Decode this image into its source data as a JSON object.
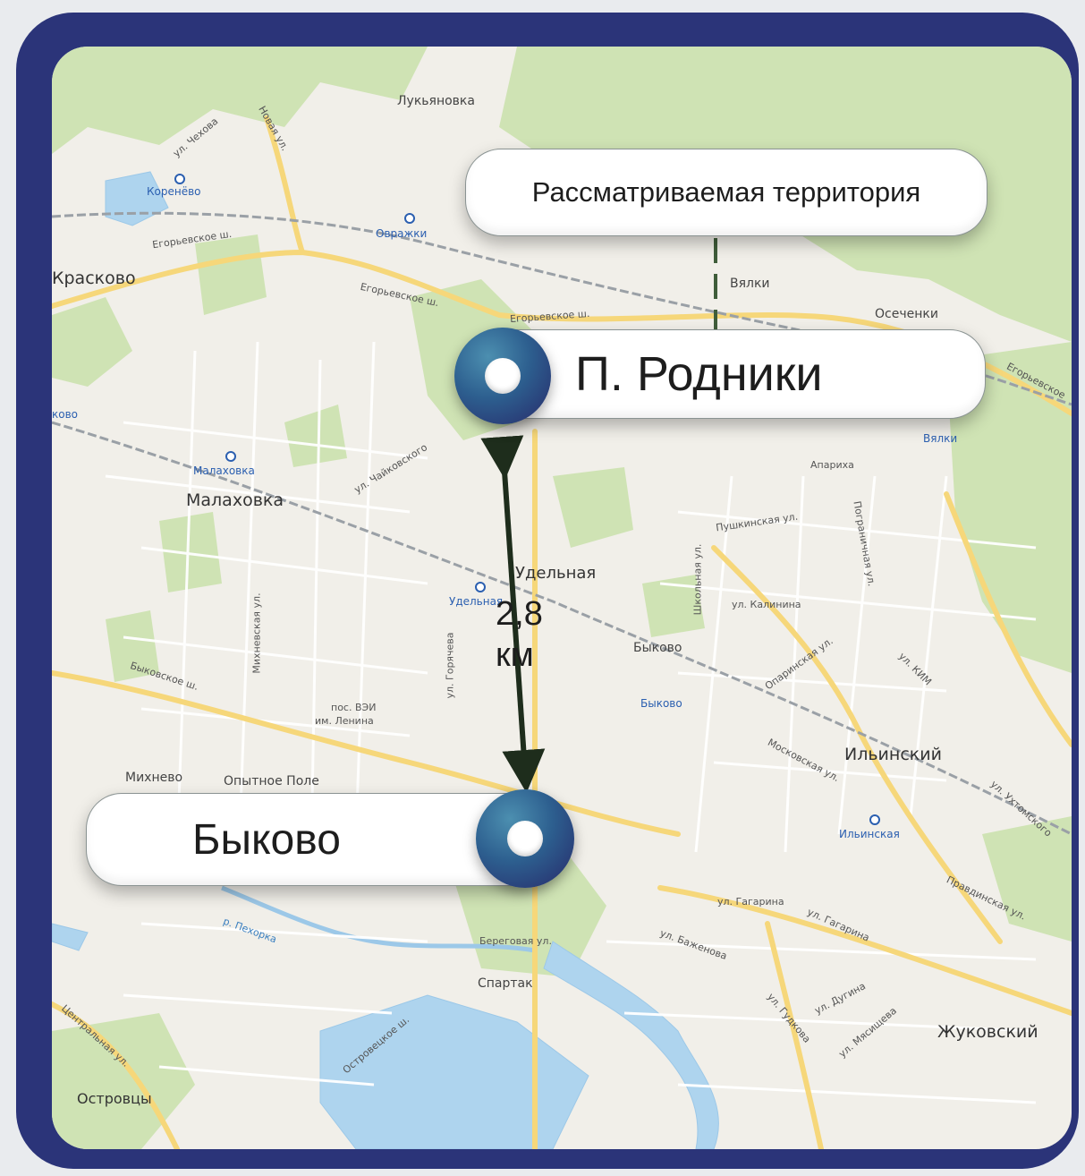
{
  "map": {
    "callouts": {
      "territory": "Рассматриваемая территория",
      "rodniki": "П. Родники",
      "bykovo": "Быково"
    },
    "distance": {
      "value": "2,8",
      "unit": "км"
    },
    "places": {
      "lukyanovka": "Лукьяновка",
      "korenevo": "Коренёво",
      "ovrazhki": "Овражки",
      "kraskovo": "Красково",
      "vyalki": "Вялки",
      "osechenki": "Осеченки",
      "vyalki_st": "Вялки",
      "apariha": "Апариха",
      "malakhovka_st": "Малаховка",
      "malakhovka": "Малаховка",
      "udelnaya": "Удельная",
      "udelnaya_st": "Удельная",
      "bykovo_town": "Быково",
      "bykovo_st": "Быково",
      "ilyinsky": "Ильинский",
      "ilyinskaya_st": "Ильинская",
      "pos_vei": "пос. ВЭИ",
      "im_lenina": "им. Ленина",
      "mikhnevo": "Михнево",
      "opytnoe_pole": "Опытное Поле",
      "spartak": "Спартак",
      "zhukovsky": "Жуковский",
      "ostrovtsy": "Островцы",
      "kosino_edge": "ково"
    },
    "roads": {
      "egor1": "Егорьевское ш.",
      "egor2": "Егорьевское ш.",
      "egor3": "Егорьевское ш.",
      "egor4": "Егорьевское",
      "chekhova": "ул. Чехова",
      "novaya": "Новая ул.",
      "chaikovskogo": "ул. Чайковского",
      "pushkinskaya": "Пушкинская ул.",
      "kalinina": "ул. Калинина",
      "shkolnaya": "Школьная ул.",
      "bykovskoe": "Быковское ш.",
      "mikhnevskaya": "Михневская ул.",
      "goryacheva": "ул. Горячева",
      "moskovskaya": "Московская ул.",
      "oparinskaya": "Опаринская ул.",
      "kim": "ул. КИМ",
      "gagarina1": "ул. Гагарина",
      "gagarina2": "ул. Гагарина",
      "beregovaya": "Береговая ул.",
      "bazhenova": "ул. Баженова",
      "gudkova": "ул. Гудкова",
      "dugina": "ул. Дугина",
      "myasishcheva": "ул. Мясищева",
      "tsentralnaya": "Центральная ул.",
      "ostrovetskoe": "Островецкое ш.",
      "pekhorka": "р. Пехорка",
      "pravdinskaya": "Правдинская ул.",
      "ukhtomskogo": "ул. Ухтомского",
      "pogranichnaya": "Пограничная ул."
    }
  }
}
